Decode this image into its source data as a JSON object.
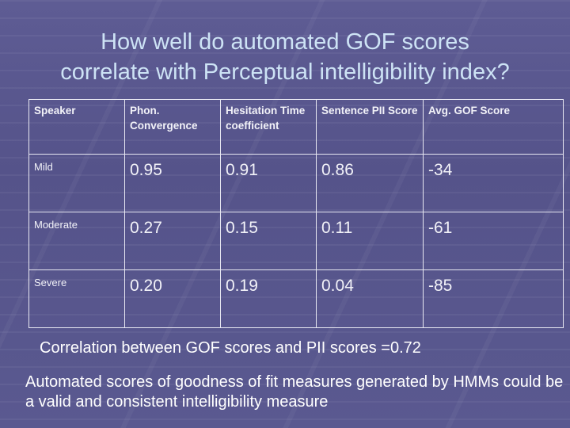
{
  "slide": {
    "title_line1": "How well do automated GOF scores",
    "title_line2": "correlate with Perceptual intelligibility index?",
    "table": {
      "headers": [
        "Speaker",
        "Phon. Convergence",
        "Hesitation Time coefficient",
        "Sentence PII Score",
        "Avg. GOF Score"
      ],
      "rows": [
        {
          "speaker": "Mild",
          "values": [
            "0.95",
            "0.91",
            "0.86",
            "-34"
          ]
        },
        {
          "speaker": "Moderate",
          "values": [
            "0.27",
            "0.15",
            "0.11",
            "-61"
          ]
        },
        {
          "speaker": "Severe",
          "values": [
            "0.20",
            "0.19",
            "0.04",
            "-85"
          ]
        }
      ]
    },
    "correlation_text": "Correlation between GOF scores and PII scores =0.72",
    "conclusion_text": "Automated scores of goodness of fit measures generated by HMMs could be a valid and consistent intelligibility measure"
  }
}
